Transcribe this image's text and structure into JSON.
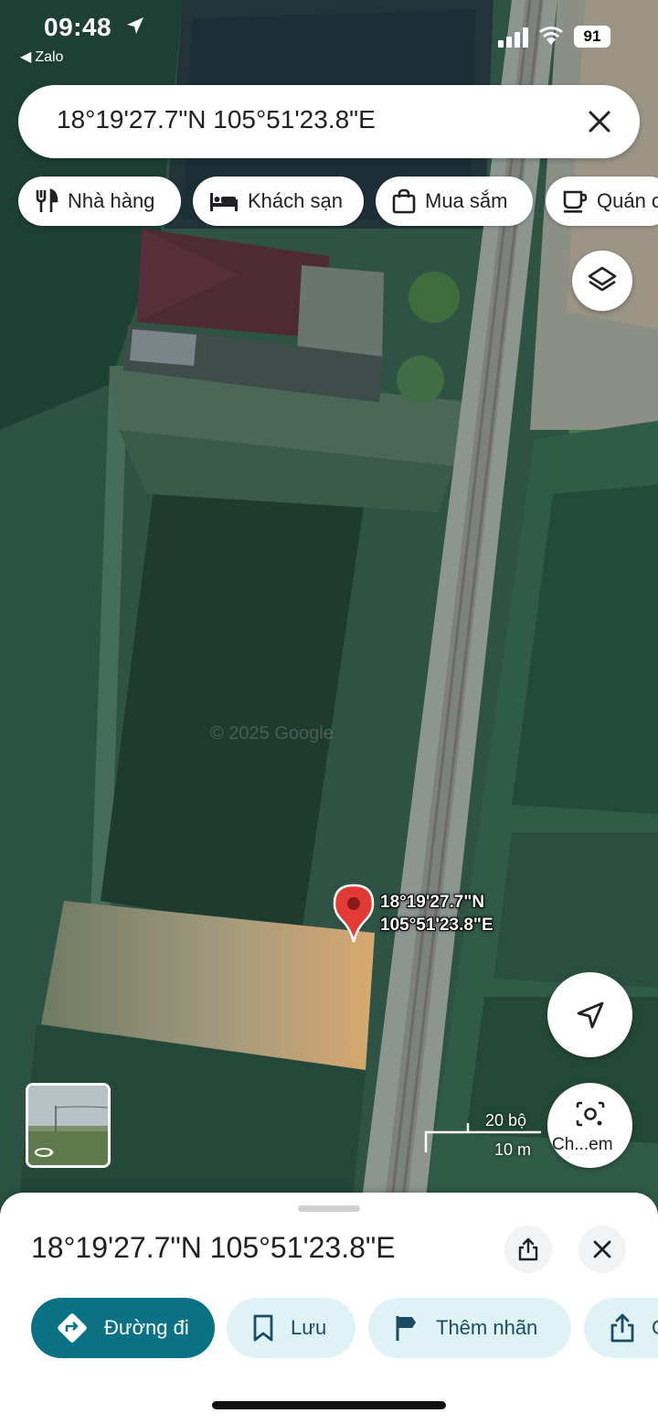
{
  "status_bar": {
    "time": "09:48",
    "back_app": "Zalo",
    "battery": "91"
  },
  "search": {
    "value": "18°19'27.7\"N 105°51'23.8\"E"
  },
  "chips": [
    {
      "label": "Nhà hàng",
      "icon": "fork-knife-icon"
    },
    {
      "label": "Khách sạn",
      "icon": "bed-icon"
    },
    {
      "label": "Mua sắm",
      "icon": "shopping-bag-icon"
    },
    {
      "label": "Quán c",
      "icon": "coffee-cup-icon"
    }
  ],
  "map": {
    "pin_label_lat": "18°19'27.7\"N",
    "pin_label_lng": "105°51'23.8\"E",
    "scale_top": "20 bộ",
    "scale_bottom": "10 m",
    "watermark": "© 2025 Google",
    "lens_label": "Ch...em"
  },
  "sheet": {
    "title": "18°19'27.7\"N 105°51'23.8\"E",
    "actions": [
      {
        "label": "Đường đi",
        "icon": "directions-icon"
      },
      {
        "label": "Lưu",
        "icon": "bookmark-icon"
      },
      {
        "label": "Thêm nhãn",
        "icon": "flag-icon"
      },
      {
        "label": "C",
        "icon": "share-icon"
      }
    ]
  },
  "colors": {
    "accent": "#0b7285",
    "chip_bg": "#dff3f7",
    "pin": "#e53935"
  }
}
